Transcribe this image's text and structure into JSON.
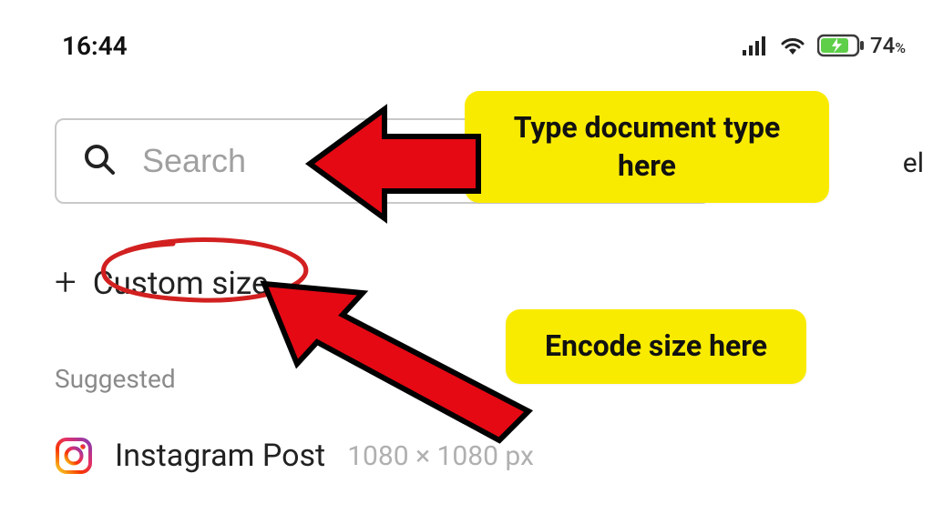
{
  "status": {
    "time": "16:44",
    "battery_percent": "74",
    "percent_symbol": "%"
  },
  "search": {
    "placeholder": "Search"
  },
  "cancel_partial": "el",
  "custom_size": {
    "label": "Custom size"
  },
  "suggested_label": "Suggested",
  "templates": {
    "instagram_post": {
      "label": "Instagram Post",
      "dimensions": "1080 × 1080 px"
    }
  },
  "annotations": {
    "callout1": "Type document type here",
    "callout2": "Encode size here"
  },
  "colors": {
    "arrow_fill": "#e50914",
    "arrow_stroke": "#000000",
    "callout_bg": "#f9eb00",
    "circle_stroke": "#d22020",
    "battery_fill": "#5fcf4a"
  }
}
